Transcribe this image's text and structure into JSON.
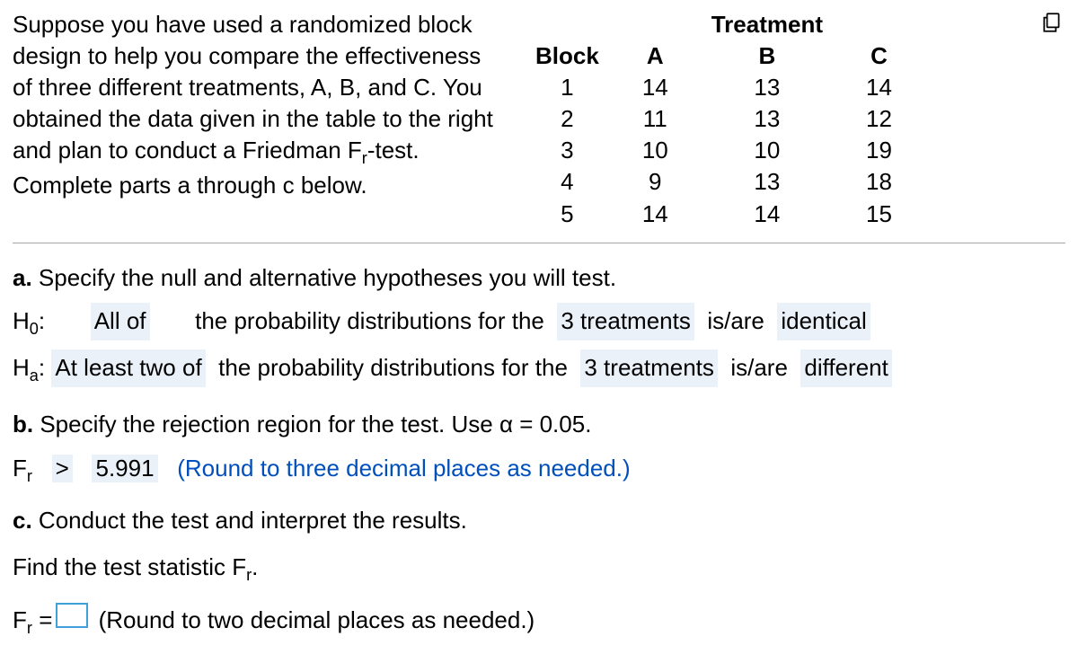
{
  "problem": {
    "intro": "Suppose you have used a randomized block design to help you compare the effectiveness of three different treatments, A, B, and C. You obtained the data given in the table to the right and plan to conduct a Friedman F",
    "intro_sub": "r",
    "intro_tail": "-test. Complete parts a through c below."
  },
  "table": {
    "treatment_label": "Treatment",
    "block_label": "Block",
    "treatment_cols": [
      "A",
      "B",
      "C"
    ],
    "rows": [
      {
        "block": "1",
        "vals": [
          "14",
          "13",
          "14"
        ]
      },
      {
        "block": "2",
        "vals": [
          "11",
          "13",
          "12"
        ]
      },
      {
        "block": "3",
        "vals": [
          "10",
          "10",
          "19"
        ]
      },
      {
        "block": "4",
        "vals": [
          "9",
          "13",
          "18"
        ]
      },
      {
        "block": "5",
        "vals": [
          "14",
          "14",
          "15"
        ]
      }
    ]
  },
  "partA": {
    "label": "a.",
    "text": "Specify the null and alternative hypotheses you will test.",
    "h0_label": "H",
    "h0_sub": "0",
    "ha_label": "H",
    "ha_sub": "a",
    "colon": ":",
    "h0_quant": "All of",
    "ha_quant": "At least two of",
    "mid_text": "the probability distributions for the",
    "subject": "3 treatments",
    "isare": "is/are",
    "h0_end": "identical",
    "ha_end": "different"
  },
  "partB": {
    "label": "b.",
    "text": "Specify the rejection region for the test. Use α = 0.05.",
    "stat": "F",
    "stat_sub": "r",
    "op": ">",
    "value": "5.991",
    "hint": "(Round to three decimal places as needed.)"
  },
  "partC": {
    "label": "c.",
    "text1": "Conduct the test and interpret the results.",
    "text2_pre": "Find the test statistic F",
    "text2_sub": "r",
    "text2_post": ".",
    "stat": "F",
    "stat_sub": "r",
    "eq": "=",
    "hint": "(Round to two decimal places as needed.)"
  }
}
